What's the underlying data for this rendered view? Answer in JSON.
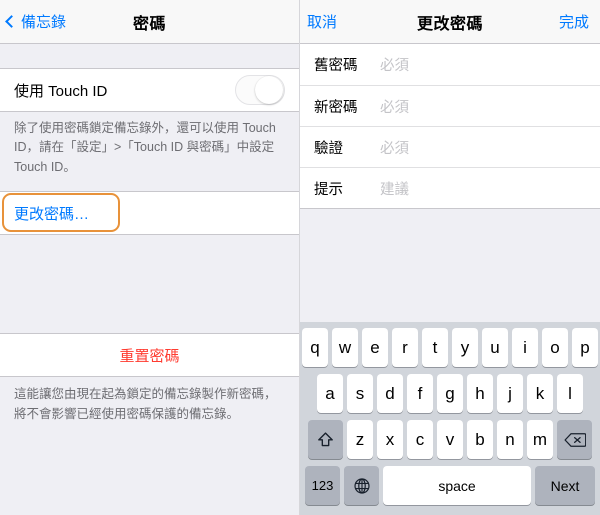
{
  "left": {
    "nav": {
      "back_label": "備忘錄",
      "back_icon": "chevron-left-icon",
      "title": "密碼"
    },
    "touch_id_row": {
      "label": "使用 Touch ID",
      "toggle_state": "off"
    },
    "touch_id_footnote": "除了使用密碼鎖定備忘錄外，還可以使用 Touch ID，請在「設定」>「Touch ID 與密碼」中設定 Touch ID。",
    "change_password_cell": {
      "label": "更改密碼…",
      "highlighted": "true",
      "highlight_color": "#e8923a"
    },
    "reset_password_cell": {
      "label": "重置密碼",
      "color": "#ff3b30"
    },
    "reset_footnote": "這能讓您由現在起為鎖定的備忘錄製作新密碼，將不會影響已經使用密碼保護的備忘錄。"
  },
  "right": {
    "nav": {
      "cancel_label": "取消",
      "title": "更改密碼",
      "done_label": "完成"
    },
    "form_rows": [
      {
        "label": "舊密碼",
        "placeholder": "必須",
        "value": ""
      },
      {
        "label": "新密碼",
        "placeholder": "必須",
        "value": ""
      },
      {
        "label": "驗證",
        "placeholder": "必須",
        "value": ""
      },
      {
        "label": "提示",
        "placeholder": "建議",
        "value": ""
      }
    ],
    "keyboard": {
      "row1": [
        "q",
        "w",
        "e",
        "r",
        "t",
        "y",
        "u",
        "i",
        "o",
        "p"
      ],
      "row2": [
        "a",
        "s",
        "d",
        "f",
        "g",
        "h",
        "j",
        "k",
        "l"
      ],
      "row3": [
        "z",
        "x",
        "c",
        "v",
        "b",
        "n",
        "m"
      ],
      "shift_icon": "shift-icon",
      "backspace_icon": "backspace-icon",
      "numbers_label": "123",
      "globe_icon": "globe-icon",
      "space_label": "space",
      "return_label": "Next"
    }
  },
  "theme": {
    "accent_blue": "#007aff",
    "destructive_red": "#ff3b30",
    "group_background": "#efeff4",
    "keyboard_background": "#d1d5db"
  }
}
